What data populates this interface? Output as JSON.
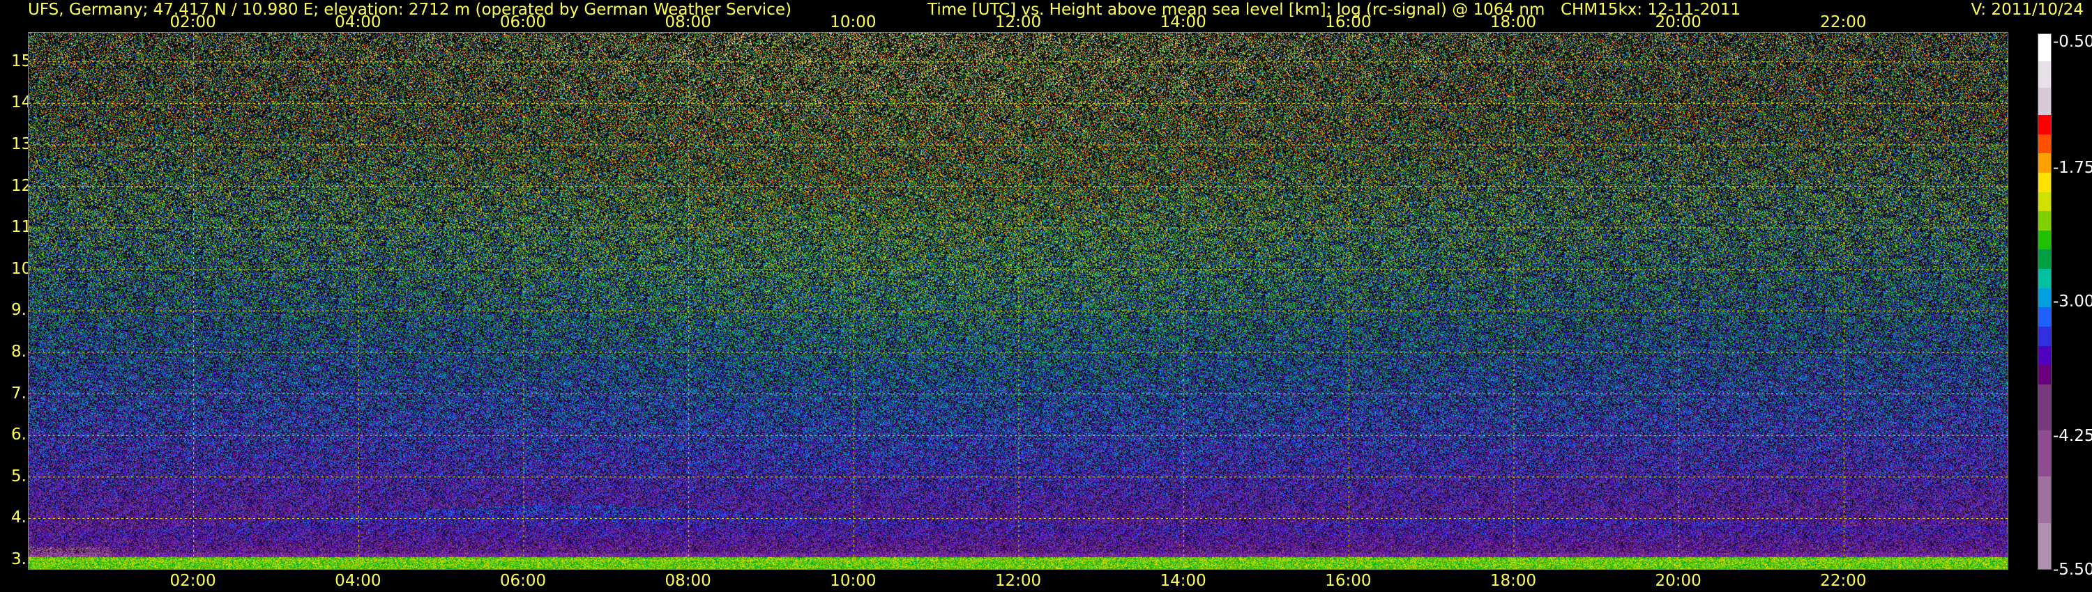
{
  "header": {
    "station": "UFS, Germany; 47.417 N / 10.980 E; elevation: 2712 m  (operated by German Weather Service)",
    "description": "Time [UTC] vs. Height above mean sea level [km]: log (rc-signal) @ 1064 nm",
    "instrument": "CHM15kx: 12-11-2011",
    "version": "V: 2011/10/24"
  },
  "colors": {
    "text": "#ffff55",
    "grid": "#d8d800",
    "background": "#000000",
    "colorbar_labels": "#ffffff"
  },
  "chart_data": {
    "type": "heatmap",
    "title": "Time [UTC] vs. Height above mean sea level [km]: log (rc-signal) @ 1064 nm",
    "xlabel": "",
    "ylabel": "",
    "x_tick_labels": [
      "02:00",
      "04:00",
      "06:00",
      "08:00",
      "10:00",
      "12:00",
      "14:00",
      "16:00",
      "18:00",
      "20:00",
      "22:00"
    ],
    "x_tick_values_hours": [
      2,
      4,
      6,
      8,
      10,
      12,
      14,
      16,
      18,
      20,
      22
    ],
    "xlim_hours": [
      0,
      24
    ],
    "y_tick_labels": [
      "3.",
      "4.",
      "5.",
      "6.",
      "7.",
      "8.",
      "9.",
      "10.",
      "11.",
      "12.",
      "13.",
      "14.",
      "15."
    ],
    "y_tick_values_km": [
      3,
      4,
      5,
      6,
      7,
      8,
      9,
      10,
      11,
      12,
      13,
      14,
      15
    ],
    "ylim_km": [
      2.75,
      15.7
    ],
    "grid": true,
    "colorbar": {
      "labels": [
        "-0.50",
        "-1.75",
        "-3.00",
        "-4.25",
        "-5.50"
      ],
      "values": [
        -0.5,
        -1.75,
        -3.0,
        -4.25,
        -5.5
      ],
      "range": [
        -5.5,
        -0.5
      ],
      "colors_top_to_bottom": [
        "#ffffff",
        "#e8e0e8",
        "#d8c8d8",
        "#ff0000",
        "#ff5000",
        "#ffa000",
        "#ffe000",
        "#d0e000",
        "#80d000",
        "#20c000",
        "#00a040",
        "#00c0a0",
        "#00a0e0",
        "#2060ff",
        "#3030e0",
        "#5000c0",
        "#6a0080",
        "#7a3a80",
        "#904c90",
        "#a070a0",
        "#b090b0"
      ]
    },
    "features": {
      "surface_layer_top_km": 3.05,
      "instrument_gap_end_hour": 1.0,
      "boundary_layer_height_km": [
        3.6,
        3.7,
        3.8,
        3.9,
        4.1,
        4.2,
        4.3,
        4.3,
        4.2,
        4.1,
        4.0,
        3.9,
        3.9,
        3.8,
        3.8,
        3.8,
        3.9,
        4.0,
        4.0,
        4.0,
        3.9,
        3.9,
        3.8,
        3.8
      ]
    }
  }
}
